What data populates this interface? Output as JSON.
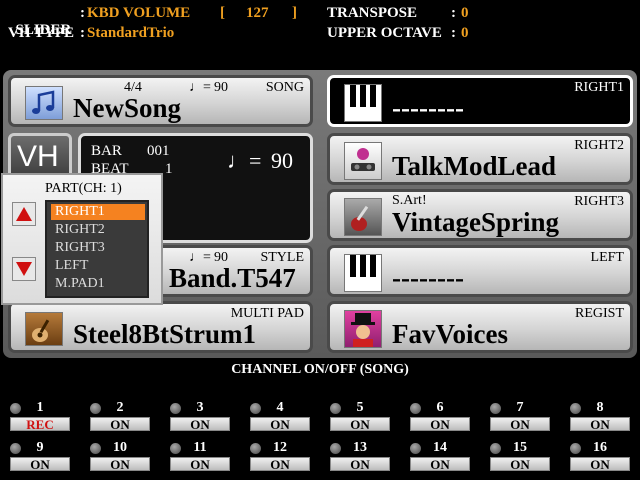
{
  "header": {
    "slider_label": "SLIDER",
    "slider_value": "KBD VOLUME",
    "slider_bracket_open": "[",
    "slider_number": "127",
    "slider_bracket_close": "]",
    "vhtype_label": "VH TYPE",
    "vhtype_value": "StandardTrio",
    "transpose_label": "TRANSPOSE",
    "transpose_value": "0",
    "upper_octave_label": "UPPER OCTAVE",
    "upper_octave_value": "0",
    "colon": ":"
  },
  "song": {
    "tag": "SONG",
    "time_sig": "4/4",
    "tempo_symbol": "♩=",
    "tempo": "90",
    "name": "NewSong"
  },
  "vh": {
    "label": "VH"
  },
  "bar_beat": {
    "bar_label": "BAR",
    "bar_value": "001",
    "beat_label": "BEAT",
    "beat_value": "1",
    "tempo_symbol": "♩=",
    "tempo": "90"
  },
  "style": {
    "tag": "STYLE",
    "tempo_symbol": "♩=",
    "tempo": "90",
    "name": "Band.T547"
  },
  "multipad": {
    "tag": "MULTI PAD",
    "name": "Steel8BtStrum1"
  },
  "right1": {
    "tag": "RIGHT1",
    "name": "--------"
  },
  "right2": {
    "tag": "RIGHT2",
    "name": "TalkModLead"
  },
  "right3": {
    "tag": "RIGHT3",
    "prefix": "S.Art!",
    "name": "VintageSpring"
  },
  "left": {
    "tag": "LEFT",
    "name": "--------"
  },
  "regist": {
    "tag": "REGIST",
    "name": "FavVoices"
  },
  "part_popup": {
    "title": "PART(CH: 1)",
    "items": [
      "RIGHT1",
      "RIGHT2",
      "RIGHT3",
      "LEFT",
      "M.PAD1"
    ],
    "selected": "RIGHT1"
  },
  "channels": {
    "title": "CHANNEL ON/OFF (SONG)",
    "list": [
      {
        "num": "1",
        "state": "REC"
      },
      {
        "num": "2",
        "state": "ON"
      },
      {
        "num": "3",
        "state": "ON"
      },
      {
        "num": "4",
        "state": "ON"
      },
      {
        "num": "5",
        "state": "ON"
      },
      {
        "num": "6",
        "state": "ON"
      },
      {
        "num": "7",
        "state": "ON"
      },
      {
        "num": "8",
        "state": "ON"
      },
      {
        "num": "9",
        "state": "ON"
      },
      {
        "num": "10",
        "state": "ON"
      },
      {
        "num": "11",
        "state": "ON"
      },
      {
        "num": "12",
        "state": "ON"
      },
      {
        "num": "13",
        "state": "ON"
      },
      {
        "num": "14",
        "state": "ON"
      },
      {
        "num": "15",
        "state": "ON"
      },
      {
        "num": "16",
        "state": "ON"
      }
    ]
  },
  "colors": {
    "accent": "#f58220",
    "header_value": "#f0a020",
    "rec": "#d01010"
  }
}
